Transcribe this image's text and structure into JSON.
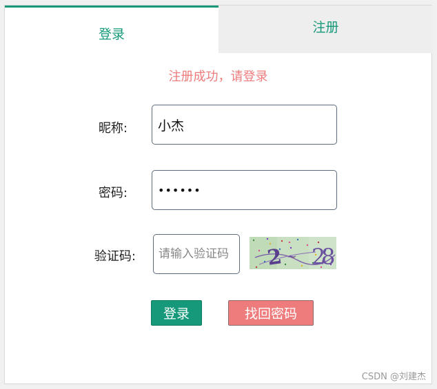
{
  "tabs": {
    "login_label": "登录",
    "register_label": "注册"
  },
  "form": {
    "message": "注册成功，请登录",
    "nickname_label": "昵称:",
    "nickname_value": "小杰",
    "password_label": "密码:",
    "password_value": "••••••",
    "captcha_label": "验证码:",
    "captcha_placeholder": "请输入验证码",
    "captcha_text": "28",
    "login_button": "登录",
    "forgot_button": "找回密码"
  },
  "watermark": "CSDN @刘建杰",
  "colors": {
    "accent": "#16997a",
    "error": "#ee7c7c",
    "tab_inactive_bg": "#eeeeee"
  }
}
